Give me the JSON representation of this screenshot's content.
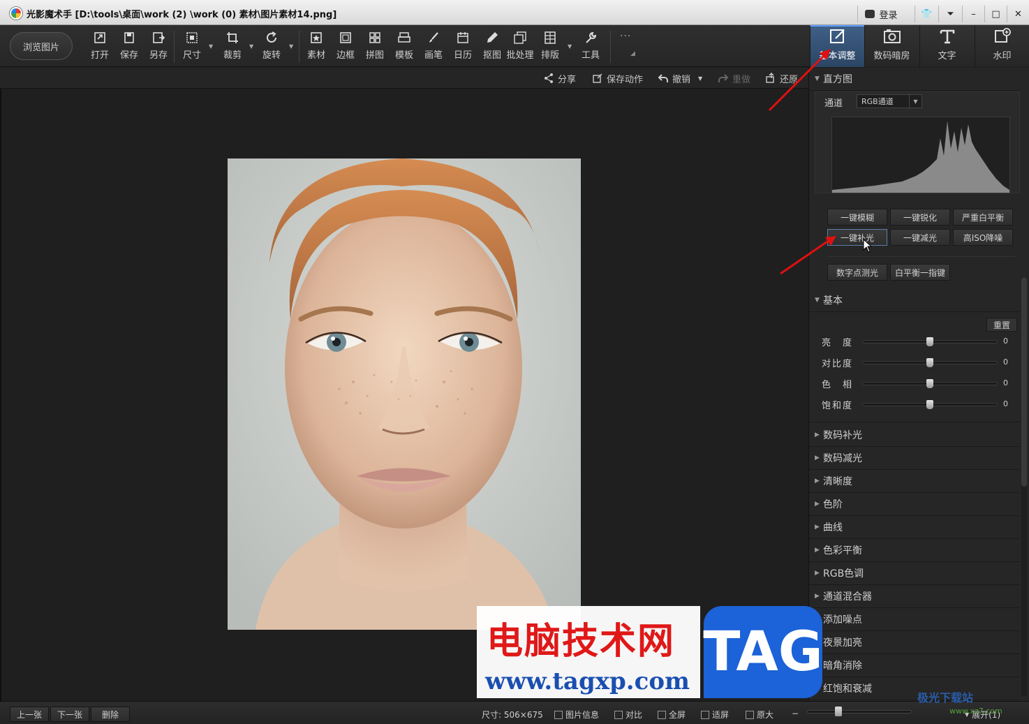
{
  "window": {
    "title": "光影魔术手  [D:\\tools\\桌面\\work (2) \\work (0) 素材\\图片素材14.png]",
    "login_label": "登录"
  },
  "toolbar": {
    "browse_label": "浏览图片",
    "tools": [
      "打开",
      "保存",
      "另存",
      "尺寸",
      "裁剪",
      "旋转",
      "素材",
      "边框",
      "拼图",
      "模板",
      "画笔",
      "日历",
      "抠图",
      "批处理",
      "排版",
      "工具"
    ]
  },
  "right_tabs": [
    "基本调整",
    "数码暗房",
    "文字",
    "水印"
  ],
  "actions": {
    "share": "分享",
    "save_action": "保存动作",
    "undo": "撤销",
    "redo": "重做",
    "restore": "还原"
  },
  "panel": {
    "histogram_title": "直方图",
    "channel_label": "通道",
    "channel_value": "RGB通道",
    "quick_buttons": [
      "一键模糊",
      "一键锐化",
      "严重白平衡",
      "一键补光",
      "一键减光",
      "高ISO降噪"
    ],
    "extra_buttons": [
      "数字点测光",
      "白平衡一指键"
    ],
    "basic_title": "基本",
    "reset_label": "重置",
    "sliders": [
      {
        "label": "亮　度",
        "value": "0",
        "level": 0.5
      },
      {
        "label": "对比度",
        "value": "0",
        "level": 0.5
      },
      {
        "label": "色　相",
        "value": "0",
        "level": 0.5
      },
      {
        "label": "饱和度",
        "value": "0",
        "level": 0.5
      }
    ],
    "sections": [
      "数码补光",
      "数码减光",
      "清晰度",
      "色阶",
      "曲线",
      "色彩平衡",
      "RGB色调",
      "通道混合器",
      "添加噪点",
      "夜景加亮",
      "暗角消除",
      "红饱和衰减"
    ]
  },
  "status": {
    "prev": "上一张",
    "next": "下一张",
    "delete": "删除",
    "size": "尺寸: 506×675",
    "info": "图片信息",
    "compare": "对比",
    "fullscreen": "全屏",
    "fit": "适屏",
    "original": "原大",
    "expand": "展开(1)",
    "zoom_level": 0.3
  },
  "watermark": {
    "title": "电脑技术网",
    "url": "www.tagxp.com",
    "tag": "TAG",
    "site2": "极光下载站",
    "site2_url": "www.xz7.com"
  }
}
